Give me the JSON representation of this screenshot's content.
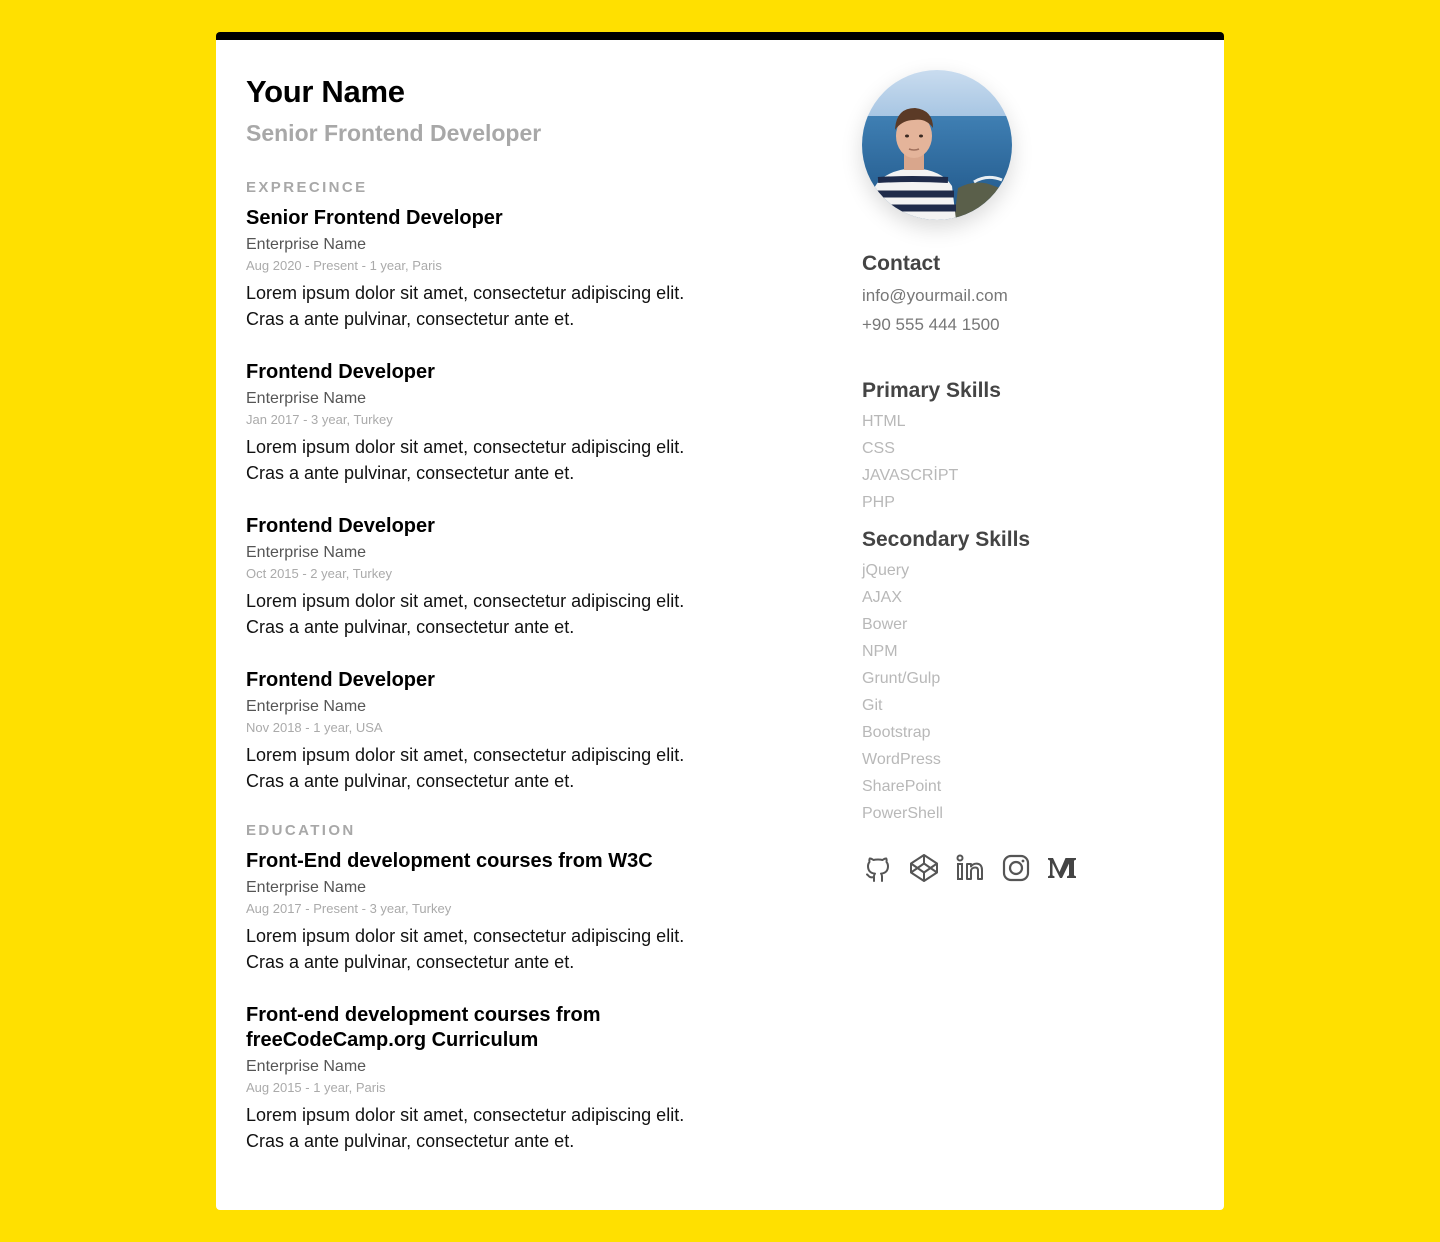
{
  "header": {
    "name": "Your Name",
    "title": "Senior Frontend Developer"
  },
  "sections": {
    "experience_label": "EXPRECINCE",
    "education_label": "EDUCATION"
  },
  "experience": [
    {
      "title": "Senior Frontend Developer",
      "company": "Enterprise Name",
      "dates": "Aug 2020 - Present - 1 year, Paris",
      "description": "Lorem ipsum dolor sit amet, consectetur adipiscing elit. Cras a ante pulvinar, consectetur ante et."
    },
    {
      "title": "Frontend Developer",
      "company": "Enterprise Name",
      "dates": "Jan 2017 - 3 year, Turkey",
      "description": "Lorem ipsum dolor sit amet, consectetur adipiscing elit. Cras a ante pulvinar, consectetur ante et."
    },
    {
      "title": "Frontend Developer",
      "company": "Enterprise Name",
      "dates": "Oct 2015 - 2 year, Turkey",
      "description": "Lorem ipsum dolor sit amet, consectetur adipiscing elit. Cras a ante pulvinar, consectetur ante et."
    },
    {
      "title": "Frontend Developer",
      "company": "Enterprise Name",
      "dates": "Nov 2018 - 1 year, USA",
      "description": "Lorem ipsum dolor sit amet, consectetur adipiscing elit. Cras a ante pulvinar, consectetur ante et."
    }
  ],
  "education": [
    {
      "title": "Front-End development courses from W3C",
      "company": "Enterprise Name",
      "dates": "Aug 2017 - Present - 3 year, Turkey",
      "description": "Lorem ipsum dolor sit amet, consectetur adipiscing elit. Cras a ante pulvinar, consectetur ante et."
    },
    {
      "title": "Front-end development courses from freeCodeCamp.org Curriculum",
      "company": "Enterprise Name",
      "dates": "Aug 2015 - 1 year, Paris",
      "description": "Lorem ipsum dolor sit amet, consectetur adipiscing elit. Cras a ante pulvinar, consectetur ante et."
    }
  ],
  "contact": {
    "heading": "Contact",
    "email": "info@yourmail.com",
    "phone": "+90 555 444 1500"
  },
  "primary_skills": {
    "heading": "Primary Skills",
    "items": [
      "HTML",
      "CSS",
      "JAVASCRİPT",
      "PHP"
    ]
  },
  "secondary_skills": {
    "heading": "Secondary Skills",
    "items": [
      "jQuery",
      "AJAX",
      "Bower",
      "NPM",
      "Grunt/Gulp",
      "Git",
      "Bootstrap",
      "WordPress",
      "SharePoint",
      "PowerShell"
    ]
  },
  "socials": [
    {
      "icon": "github-icon"
    },
    {
      "icon": "codepen-icon"
    },
    {
      "icon": "linkedin-icon"
    },
    {
      "icon": "instagram-icon"
    },
    {
      "icon": "medium-icon"
    }
  ],
  "colors": {
    "background": "#FFE000",
    "card": "#FFFFFF",
    "card_top_border": "#000000",
    "muted_text": "#A8A8A8"
  }
}
